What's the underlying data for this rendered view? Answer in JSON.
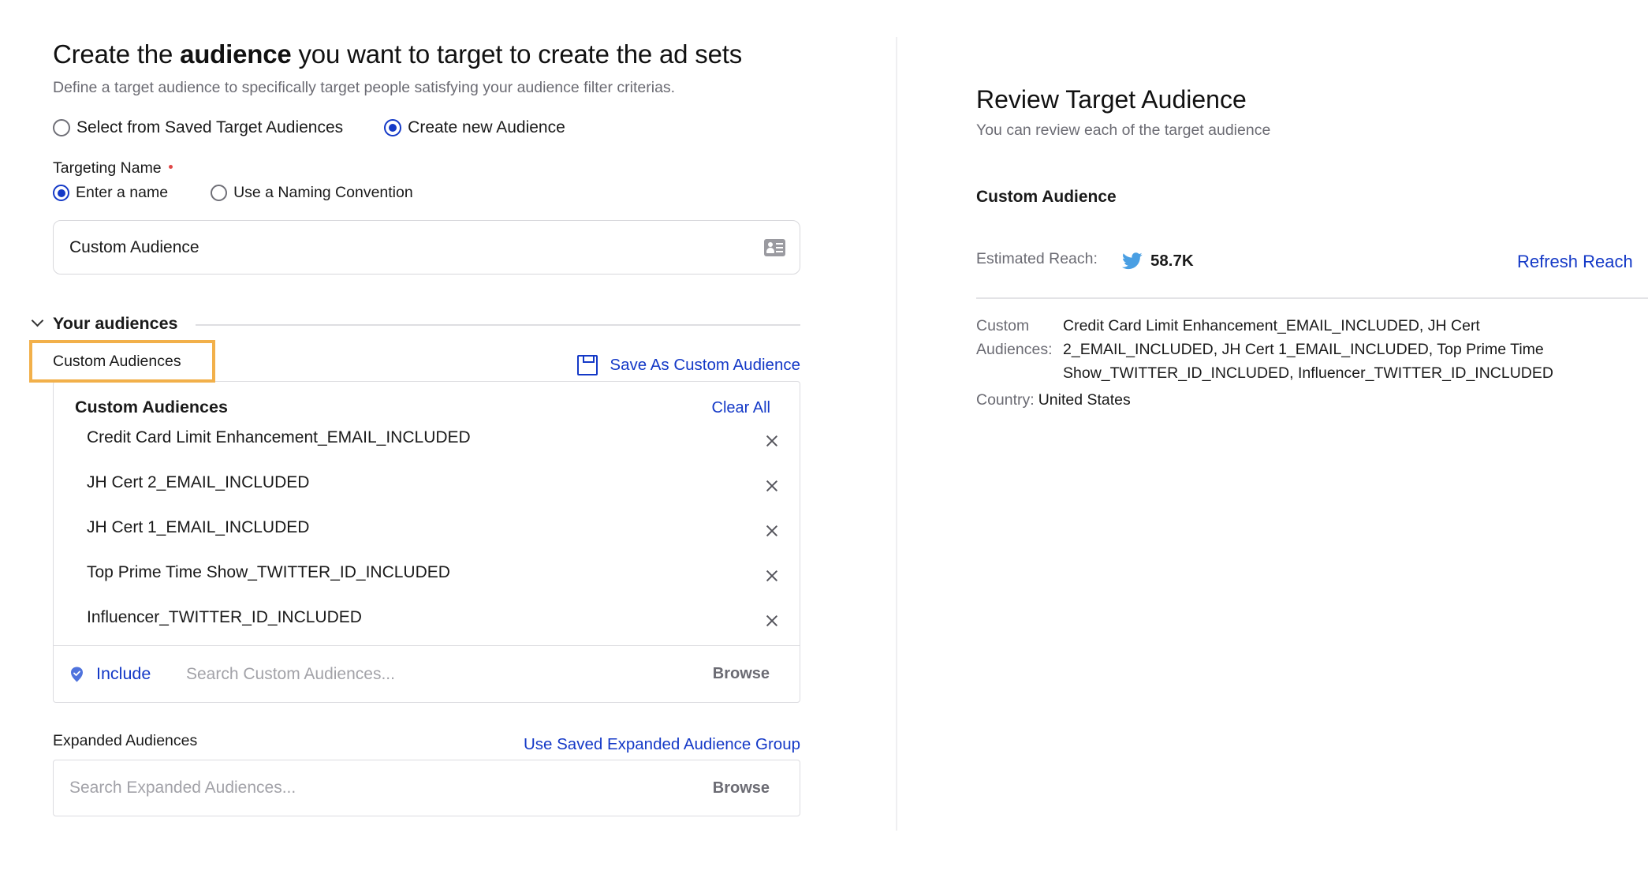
{
  "left": {
    "heading": {
      "prefix": "Create the ",
      "bold": "audience",
      "suffix": " you want to target to create the ad sets"
    },
    "subtitle": "Define a target audience to specifically target people satisfying your audience filter criterias.",
    "mode_options": [
      {
        "label": "Select from Saved Target Audiences",
        "checked": false
      },
      {
        "label": "Create new Audience",
        "checked": true
      }
    ],
    "targeting_name": {
      "label": "Targeting Name",
      "required": true,
      "options": [
        {
          "label": "Enter a name",
          "checked": true
        },
        {
          "label": "Use a Naming Convention",
          "checked": false
        }
      ],
      "value": "Custom Audience",
      "icon": "contact-card-icon"
    },
    "your_audiences": {
      "title": "Your audiences",
      "expanded": true,
      "custom_audiences_label": "Custom Audiences",
      "save_as_label": "Save As Custom Audience",
      "card": {
        "title": "Custom Audiences",
        "clear_all": "Clear All",
        "items": [
          "Credit Card Limit Enhancement_EMAIL_INCLUDED",
          "JH Cert 2_EMAIL_INCLUDED",
          "JH Cert 1_EMAIL_INCLUDED",
          "Top Prime Time Show_TWITTER_ID_INCLUDED",
          "Influencer_TWITTER_ID_INCLUDED"
        ]
      },
      "search": {
        "include_label": "Include",
        "placeholder": "Search Custom Audiences...",
        "value": "",
        "browse": "Browse"
      }
    },
    "expanded_audiences": {
      "label": "Expanded Audiences",
      "link": "Use Saved Expanded Audience Group",
      "placeholder": "Search Expanded Audiences...",
      "value": "",
      "browse": "Browse"
    }
  },
  "right": {
    "title": "Review Target Audience",
    "subtitle": "You can review each of the target audience",
    "audience_name": "Custom Audience",
    "estimated_reach_label": "Estimated Reach:",
    "estimated_reach_value": "58.7K",
    "platform_icon": "twitter-icon",
    "refresh_label": "Refresh Reach",
    "details": {
      "custom_audiences_key": "Custom Audiences:",
      "custom_audiences_value": "Credit Card Limit Enhancement_EMAIL_INCLUDED, JH Cert 2_EMAIL_INCLUDED, JH Cert 1_EMAIL_INCLUDED, Top Prime Time Show_TWITTER_ID_INCLUDED, Influencer_TWITTER_ID_INCLUDED",
      "country_key": "Country:",
      "country_value": "United States"
    }
  },
  "colors": {
    "accent": "#1439c7",
    "highlight": "#f2b04a",
    "required": "#e04848",
    "twitter": "#4a9fe3",
    "muted_text": "#6b6b73"
  }
}
